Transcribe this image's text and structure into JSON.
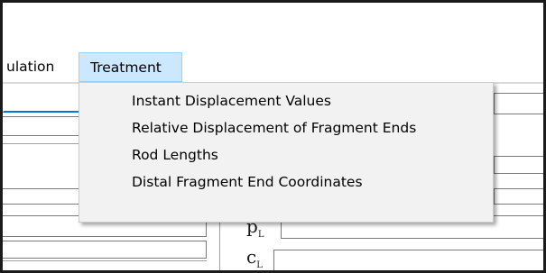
{
  "menubar": {
    "items": [
      {
        "label": "ulation"
      },
      {
        "label": "Treatment"
      }
    ]
  },
  "dropdown": {
    "items": [
      {
        "label": "Instant Displacement Values"
      },
      {
        "label": "Relative Displacement of Fragment Ends"
      },
      {
        "label": "Rod Lengths"
      },
      {
        "label": "Distal Fragment End Coordinates"
      }
    ]
  },
  "form": {
    "label_p_main": "p",
    "label_p_sub": "L",
    "label_c_main": "c",
    "label_c_sub": "L"
  },
  "colors": {
    "menu_highlight": "#cce8ff",
    "menu_highlight_border": "#99d1ff",
    "dropdown_bg": "#f2f2f2",
    "focus_line": "#0078d7"
  }
}
